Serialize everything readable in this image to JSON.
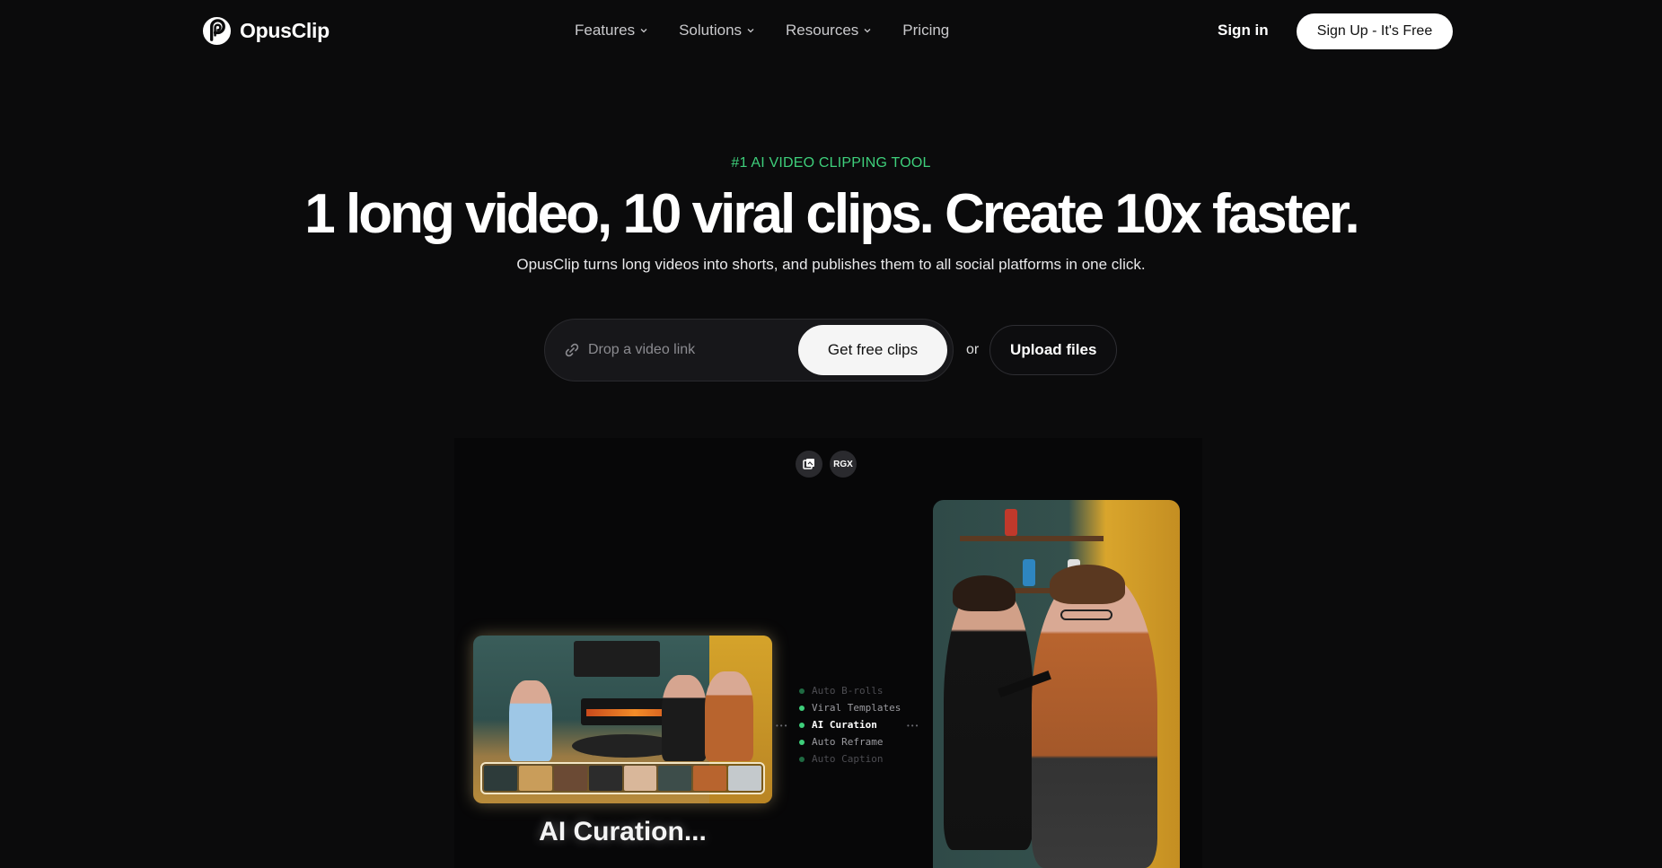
{
  "header": {
    "logo_text": "OpusClip",
    "nav": [
      {
        "label": "Features",
        "has_dropdown": true
      },
      {
        "label": "Solutions",
        "has_dropdown": true
      },
      {
        "label": "Resources",
        "has_dropdown": true
      },
      {
        "label": "Pricing",
        "has_dropdown": false
      }
    ],
    "signin_label": "Sign in",
    "signup_label": "Sign Up - It's Free"
  },
  "hero": {
    "eyebrow": "#1 AI VIDEO CLIPPING TOOL",
    "headline": "1 long video, 10 viral clips. Create 10x faster.",
    "subhead": "OpusClip turns long videos into shorts, and publishes them to all social platforms in one click.",
    "link_placeholder": "Drop a video link",
    "get_clips_label": "Get free clips",
    "or_label": "or",
    "upload_label": "Upload files"
  },
  "demo": {
    "badges": [
      "",
      "RGX"
    ],
    "steps": [
      {
        "label": "Auto B-rolls",
        "state": "dim"
      },
      {
        "label": "Viral Templates",
        "state": "normal"
      },
      {
        "label": "AI Curation",
        "state": "active"
      },
      {
        "label": "Auto Reframe",
        "state": "normal"
      },
      {
        "label": "Auto Caption",
        "state": "dim"
      }
    ],
    "caption": "AI Curation..."
  },
  "colors": {
    "accent_green": "#3ecf7b",
    "background": "#0b0b0c"
  }
}
